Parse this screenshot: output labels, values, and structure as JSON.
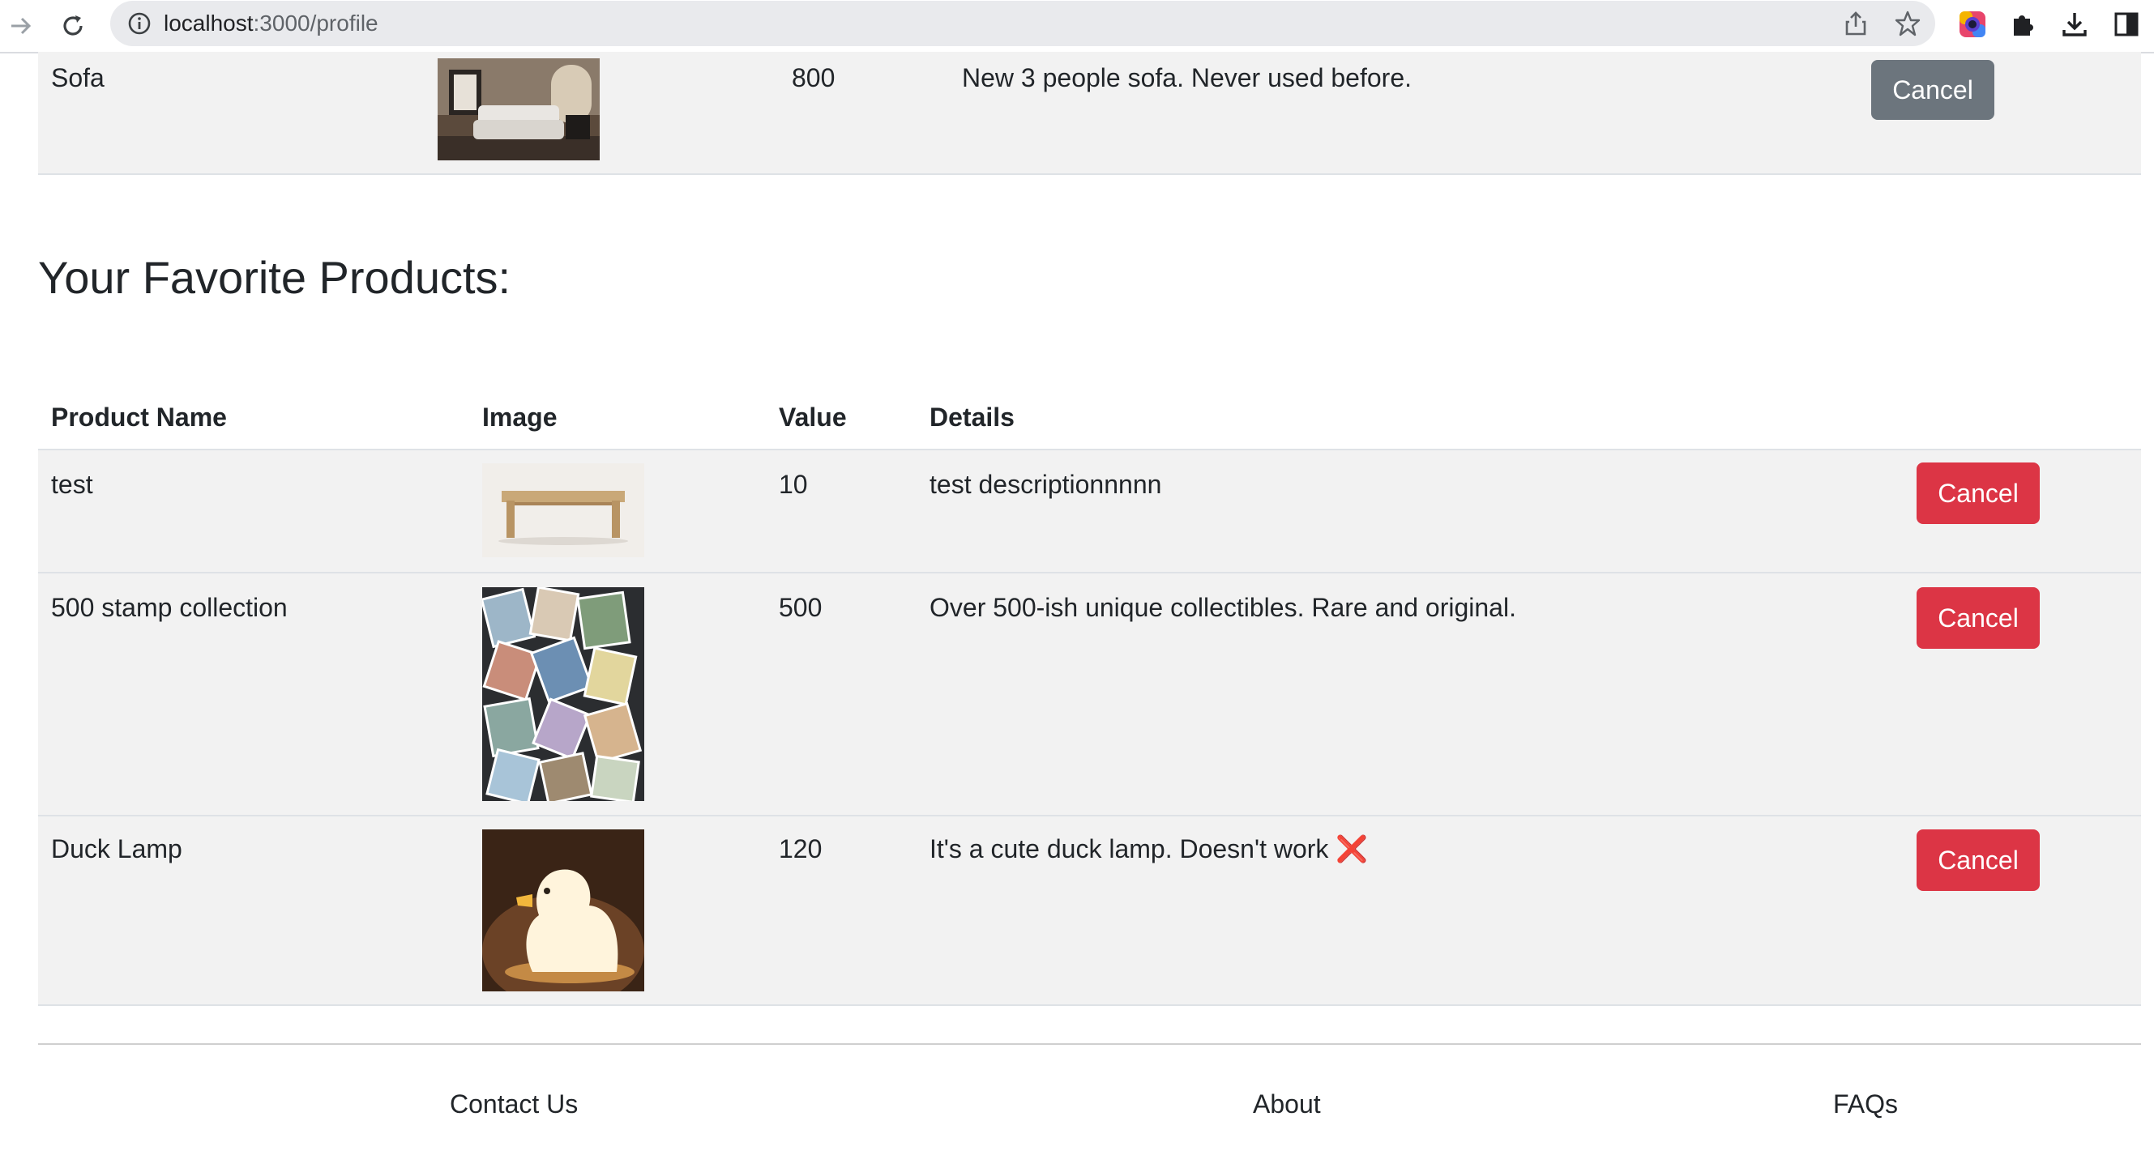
{
  "browser": {
    "url_host": "localhost",
    "url_path": ":3000/profile"
  },
  "listing": {
    "name": "Sofa",
    "value": "800",
    "details": "New 3 people sofa. Never used before.",
    "button_label": "Cancel"
  },
  "favorites": {
    "title": "Your Favorite Products:",
    "columns": [
      "Product Name",
      "Image",
      "Value",
      "Details"
    ],
    "rows": [
      {
        "name": "test",
        "value": "10",
        "details": "test descriptionnnnn",
        "button_label": "Cancel"
      },
      {
        "name": "500 stamp collection",
        "value": "500",
        "details": "Over 500-ish unique collectibles. Rare and original.",
        "button_label": "Cancel"
      },
      {
        "name": "Duck Lamp",
        "value": "120",
        "details": "It's a cute duck lamp. Doesn't work",
        "details_emoji": "❌",
        "button_label": "Cancel"
      }
    ]
  },
  "footer": {
    "links": [
      "Contact Us",
      "About",
      "FAQs"
    ]
  },
  "colors": {
    "cancel_grey": "#6c757d",
    "cancel_red": "#dc3545",
    "row_bg": "#f2f2f2"
  }
}
